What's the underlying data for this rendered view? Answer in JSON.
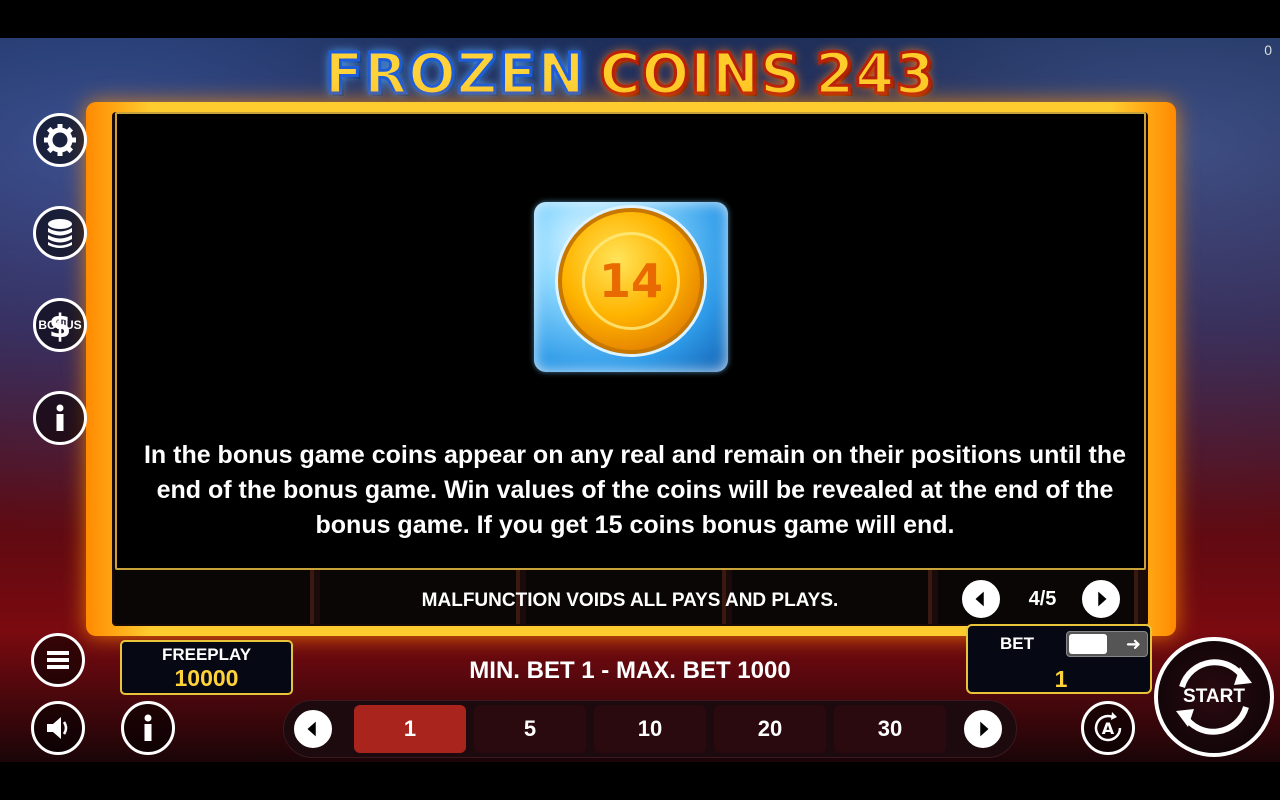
{
  "counter": "0",
  "title": {
    "word1": "FROZEN",
    "word2": "COINS",
    "word3": "243"
  },
  "info": {
    "coin_number": "14",
    "description": "In the bonus game coins appear on any real and remain on their positions until the end of the bonus game. Win values of the coins will be revealed at the end of the bonus game. If you get 15 coins bonus game will end.",
    "malfunction": "MALFUNCTION VOIDS ALL PAYS AND PLAYS.",
    "page": "4/5"
  },
  "sidebar": {
    "icons": [
      "gear-icon",
      "coins-stack-icon",
      "bonus-dollar-icon",
      "info-icon"
    ],
    "bonus_label": "BONUS"
  },
  "bottom": {
    "freeplay_label": "FREEPLAY",
    "freeplay_value": "10000",
    "bet_range": "MIN. BET 1 - MAX. BET 1000",
    "bet_label": "BET",
    "bet_value": "1",
    "bet_options": [
      "1",
      "5",
      "10",
      "20",
      "30"
    ],
    "selected_bet": "1",
    "start_label": "START"
  },
  "colors": {
    "accent_gold": "#e8c43a",
    "selected_bet": "#a8241c",
    "frame_orange": "#ffcc30"
  }
}
